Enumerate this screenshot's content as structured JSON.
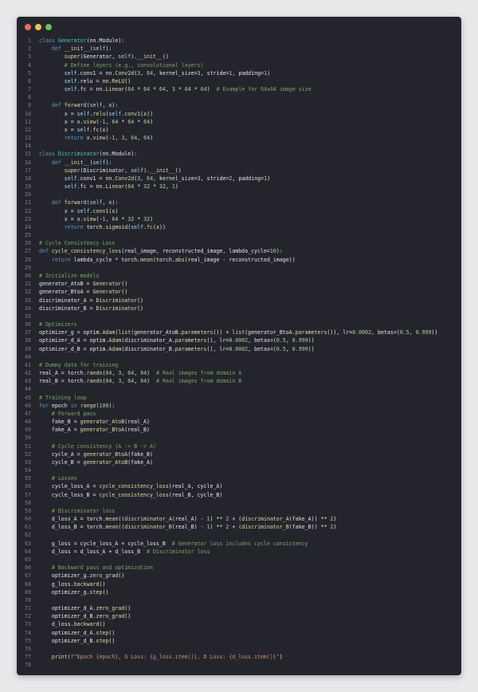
{
  "window": {
    "controls": [
      {
        "name": "close-button",
        "color": "#ed6a5e"
      },
      {
        "name": "minimize-button",
        "color": "#f5bf4f"
      },
      {
        "name": "maximize-button",
        "color": "#61c454"
      }
    ]
  },
  "editor": {
    "colors": {
      "background": "#24252c",
      "keyword": "#569cd6",
      "function": "#dcdcaa",
      "class": "#4ec9b0",
      "string": "#ce9178",
      "number": "#b5cea8",
      "comment": "#7ca668",
      "text": "#e6e6e6",
      "line_number": "#7e8189"
    },
    "lines": [
      "class Generator(nn.Module):",
      "    def __init__(self):",
      "        super(Generator, self).__init__()",
      "        # Define layers (e.g., convolutional layers)",
      "        self.conv1 = nn.Conv2d(3, 64, kernel_size=3, stride=1, padding=1)",
      "        self.relu = nn.ReLU()",
      "        self.fc = nn.Linear(64 * 64 * 64, 3 * 64 * 64)  # Example for 64x64 image size",
      "",
      "    def forward(self, x):",
      "        x = self.relu(self.conv1(x))",
      "        x = x.view(-1, 64 * 64 * 64)",
      "        x = self.fc(x)",
      "        return x.view(-1, 3, 64, 64)",
      "",
      "class Discriminator(nn.Module):",
      "    def __init__(self):",
      "        super(Discriminator, self).__init__()",
      "        self.conv1 = nn.Conv2d(3, 64, kernel_size=3, stride=2, padding=1)",
      "        self.fc = nn.Linear(64 * 32 * 32, 1)",
      "",
      "    def forward(self, x):",
      "        x = self.conv1(x)",
      "        x = x.view(-1, 64 * 32 * 32)",
      "        return torch.sigmoid(self.fc(x))",
      "",
      "# Cycle Consistency Loss",
      "def cycle_consistency_loss(real_image, reconstructed_image, lambda_cycle=10):",
      "    return lambda_cycle * torch.mean(torch.abs(real_image - reconstructed_image))",
      "",
      "# Initialize models",
      "generator_AtoB = Generator()",
      "generator_BtoA = Generator()",
      "discriminator_A = Discriminator()",
      "discriminator_B = Discriminator()",
      "",
      "# Optimizers",
      "optimizer_g = optim.Adam(list(generator_AtoB.parameters()) + list(generator_BtoA.parameters()), lr=0.0002, betas=(0.5, 0.999))",
      "optimizer_d_A = optim.Adam(discriminator_A.parameters(), lr=0.0002, betas=(0.5, 0.999))",
      "optimizer_d_B = optim.Adam(discriminator_B.parameters(), lr=0.0002, betas=(0.5, 0.999))",
      "",
      "# Dummy data for training",
      "real_A = torch.randn(64, 3, 64, 64)  # Real images from domain A",
      "real_B = torch.randn(64, 3, 64, 64)  # Real images from domain B",
      "",
      "# Training loop",
      "for epoch in range(100):",
      "    # Forward pass",
      "    fake_B = generator_AtoB(real_A)",
      "    fake_A = generator_BtoA(real_B)",
      "",
      "    # Cycle consistency (A -> B -> A)",
      "    cycle_A = generator_BtoA(fake_B)",
      "    cycle_B = generator_AtoB(fake_A)",
      "",
      "    # Losses",
      "    cycle_loss_A = cycle_consistency_loss(real_A, cycle_A)",
      "    cycle_loss_B = cycle_consistency_loss(real_B, cycle_B)",
      "",
      "    # Discriminator loss",
      "    d_loss_A = torch.mean((discriminator_A(real_A) - 1) ** 2 + (discriminator_A(fake_A)) ** 2)",
      "    d_loss_B = torch.mean((discriminator_B(real_B) - 1) ** 2 + (discriminator_B(fake_B)) ** 2)",
      "",
      "    g_loss = cycle_loss_A + cycle_loss_B  # Generator loss includes cycle consistency",
      "    d_loss = d_loss_A + d_loss_B  # Discriminator loss",
      "",
      "    # Backward pass and optimization",
      "    optimizer_g.zero_grad()",
      "    g_loss.backward()",
      "    optimizer_g.step()",
      "",
      "    optimizer_d_A.zero_grad()",
      "    optimizer_d_B.zero_grad()",
      "    d_loss.backward()",
      "    optimizer_d_A.step()",
      "    optimizer_d_B.step()",
      "",
      "    print(f\"Epoch {epoch}, G Loss: {g_loss.item()}, D Loss: {d_loss.item()}\")",
      ""
    ]
  }
}
